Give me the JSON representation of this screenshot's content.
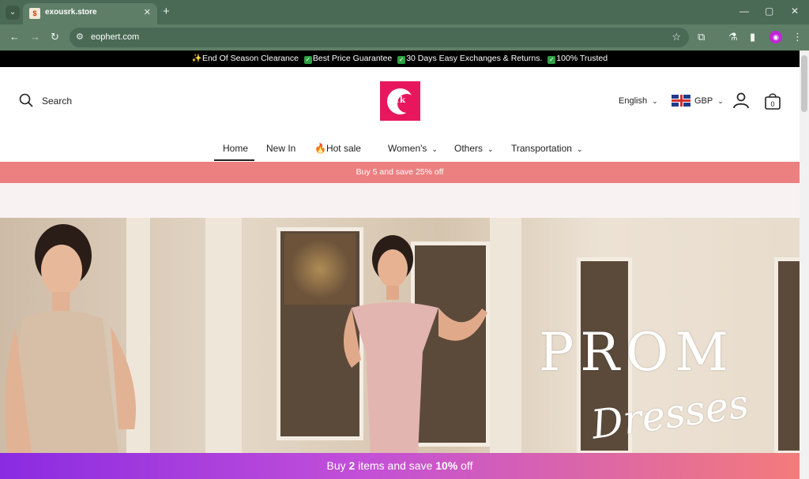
{
  "browser": {
    "tab_title": "exousrk.store",
    "url": "eophert.com"
  },
  "announcement": {
    "part1": "✨End Of Season Clearance",
    "part2": "Best Price Guarantee",
    "part3": "30 Days Easy Exchanges & Returns.",
    "part4": "100% Trusted"
  },
  "header": {
    "search_label": "Search",
    "logo_text": "1k",
    "language": "English",
    "currency": "GBP",
    "cart_count": "0"
  },
  "nav": {
    "items": [
      "Home",
      "New In",
      "🔥Hot sale",
      "Women's",
      "Others",
      "Transportation"
    ]
  },
  "promo_bar": "Buy 5 and save 25% off",
  "hero": {
    "title": "PROM",
    "subtitle": "Dresses"
  },
  "bottom_bar": {
    "prefix": "Buy ",
    "qty": "2",
    "middle": " items and save ",
    "pct": "10%",
    "suffix": " off"
  },
  "colors": {
    "promo_bar": "#ec8080",
    "logo": "#e8175d",
    "chrome": "#5f7e68"
  }
}
